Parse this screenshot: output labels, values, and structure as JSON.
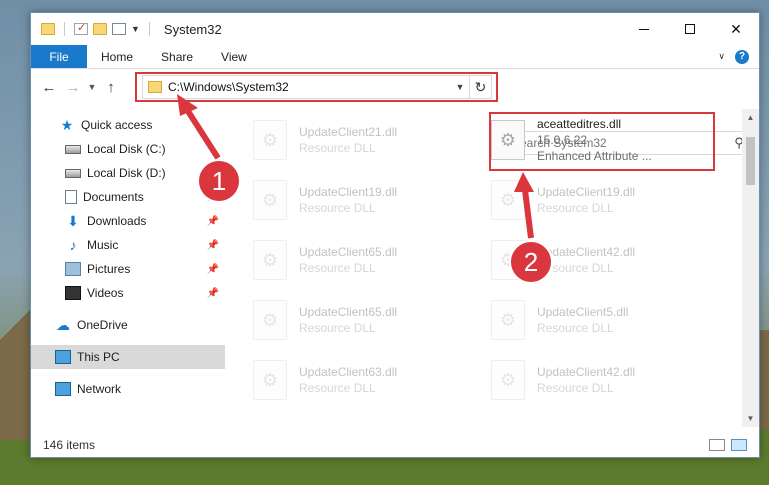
{
  "window": {
    "title": "System32",
    "controls": [
      "minimize-icon",
      "maximize-icon",
      "close-icon"
    ]
  },
  "ribbon": {
    "file_tab": "File",
    "tabs": [
      "Home",
      "Share",
      "View"
    ]
  },
  "navigation": {
    "address": "C:\\Windows\\System32",
    "search_placeholder": "Search System32"
  },
  "sidebar": {
    "items": [
      {
        "label": "Quick access",
        "icon": "star-icon"
      },
      {
        "label": "Local Disk (C:)",
        "icon": "disk-icon"
      },
      {
        "label": "Local Disk (D:)",
        "icon": "disk-icon"
      },
      {
        "label": "Documents",
        "icon": "documents-icon",
        "pinned": true
      },
      {
        "label": "Downloads",
        "icon": "download-icon",
        "pinned": true
      },
      {
        "label": "Music",
        "icon": "music-icon",
        "pinned": true
      },
      {
        "label": "Pictures",
        "icon": "pictures-icon",
        "pinned": true
      },
      {
        "label": "Videos",
        "icon": "videos-icon",
        "pinned": true
      },
      {
        "label": "OneDrive",
        "icon": "cloud-icon"
      },
      {
        "label": "This PC",
        "icon": "pc-icon",
        "selected": true
      },
      {
        "label": "Network",
        "icon": "network-icon"
      }
    ]
  },
  "files": {
    "highlighted": {
      "name": "aceatteditres.dll",
      "version": "15.0.6.22",
      "description": "Enhanced Attribute ..."
    },
    "left_column": [
      {
        "name": "UpdateClient21.dll",
        "type": "Resource DLL"
      },
      {
        "name": "UpdateClient19.dll",
        "type": "Resource DLL"
      },
      {
        "name": "UpdateClient65.dll",
        "type": "Resource DLL"
      },
      {
        "name": "UpdateClient65.dll",
        "type": "Resource DLL"
      },
      {
        "name": "UpdateClient63.dll",
        "type": "Resource DLL"
      }
    ],
    "right_column": [
      {
        "name": "UpdateClient19.dll",
        "type": "Resource DLL"
      },
      {
        "name": "UpdateClient42.dll",
        "type": "Resource DLL"
      },
      {
        "name": "UpdateClient5.dll",
        "type": "Resource DLL"
      },
      {
        "name": "UpdateClient42.dll",
        "type": "Resource DLL"
      }
    ]
  },
  "status": {
    "item_count": "146 items"
  },
  "annotations": {
    "step1": "1",
    "step2": "2",
    "color": "#d9363e"
  }
}
